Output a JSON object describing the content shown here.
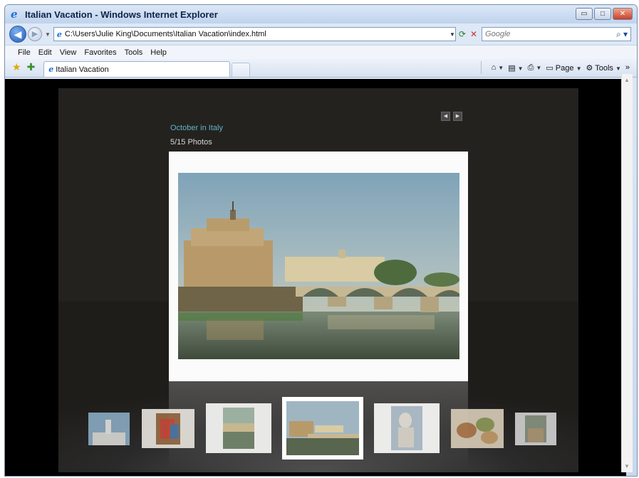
{
  "window": {
    "title": "Italian Vacation - Windows Internet Explorer"
  },
  "address": {
    "url": "C:\\Users\\Julie King\\Documents\\Italian Vacation\\index.html"
  },
  "search": {
    "placeholder": "Google"
  },
  "menu": [
    "File",
    "Edit",
    "View",
    "Favorites",
    "Tools",
    "Help"
  ],
  "tab": {
    "label": "Italian Vacation"
  },
  "commandbar": {
    "page_label": "Page",
    "tools_label": "Tools"
  },
  "gallery": {
    "title": "October in Italy",
    "count": "5/15 Photos"
  },
  "thumbnails": [
    {
      "subject": "statue-rooftop"
    },
    {
      "subject": "painting"
    },
    {
      "subject": "river-bridge"
    },
    {
      "subject": "castel-sant-angelo",
      "active": true
    },
    {
      "subject": "marble-statue"
    },
    {
      "subject": "food"
    },
    {
      "subject": "street"
    }
  ],
  "colors": {
    "gallery_title": "#5fb4c9",
    "stage_bg": "#24221f"
  }
}
